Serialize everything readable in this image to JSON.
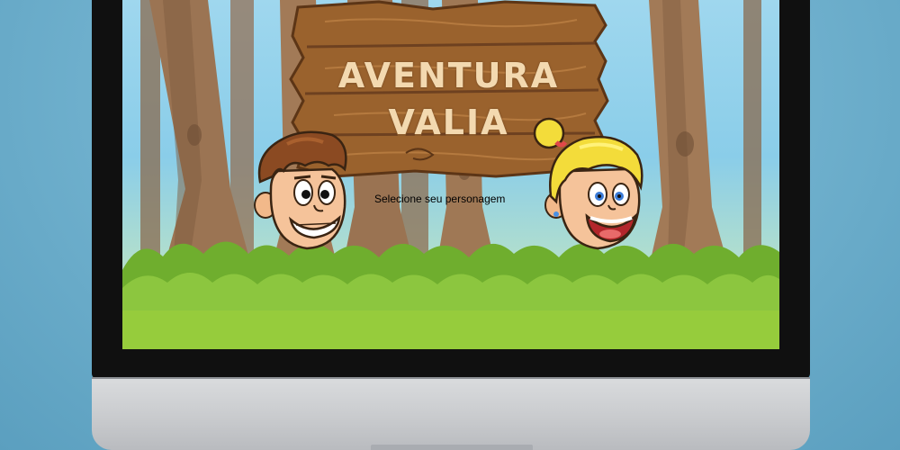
{
  "game": {
    "title_line1": "AVENTURA",
    "title_line2": "VALIA",
    "subtitle": "Selecione seu personagem"
  },
  "characters": [
    {
      "id": "boy",
      "icon": "boy-character-icon",
      "hair_color": "#8b4a22"
    },
    {
      "id": "girl",
      "icon": "girl-character-icon",
      "hair_color": "#f3dc3a"
    }
  ],
  "colors": {
    "sky": "#8acde9",
    "grass": "#8cc63f",
    "wood": "#9a622d",
    "title_text": "#f3d9b0"
  }
}
